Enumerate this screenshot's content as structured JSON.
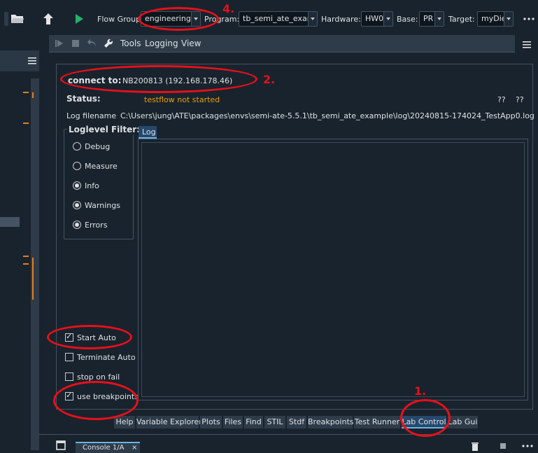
{
  "toolbar": {
    "flow_group_label": "Flow Group:",
    "flow_group_value": "engineering",
    "program_label": "Program:",
    "program_value": "tb_semi_ate_exam",
    "hardware_label": "Hardware:",
    "hardware_value": "HW0",
    "base_label": "Base:",
    "base_value": "PR",
    "target_label": "Target:",
    "target_value": "myDie"
  },
  "subtoolbar": {
    "menu_items": [
      "Tools",
      "Logging",
      "View"
    ]
  },
  "panel": {
    "connect_label": "connect to:",
    "connect_value": "NB200813 (192.168.178.46)",
    "status_label": "Status:",
    "status_value": "testflow not started",
    "status_q1": "??",
    "status_q2": "??",
    "log_filename_label": "Log filename",
    "log_filename_value": "C:\\Users\\jung\\ATE\\packages\\envs\\semi-ate-5.5.1\\tb_semi_ate_example\\log\\20240815-174024_TestApp0.log",
    "loglevel_title": "Loglevel Filter:",
    "loglevels": [
      {
        "label": "Debug",
        "selected": false
      },
      {
        "label": "Measure",
        "selected": false
      },
      {
        "label": "Info",
        "selected": true
      },
      {
        "label": "Warnings",
        "selected": true
      },
      {
        "label": "Errors",
        "selected": true
      }
    ],
    "log_tab": "Log",
    "options": [
      {
        "label": "Start Auto",
        "checked": true
      },
      {
        "label": "Terminate Auto",
        "checked": false
      },
      {
        "label": "stop on fail",
        "checked": false
      },
      {
        "label": "use breakpoints",
        "checked": true
      }
    ]
  },
  "bottom_tabs": [
    "Help",
    "Variable Explorer",
    "Plots",
    "Files",
    "Find",
    "STIL",
    "Stdf",
    "Breakpoints",
    "Test Runner",
    "Lab Control",
    "Lab Gui"
  ],
  "active_bottom_tab": "Lab Control",
  "console_tab": "Console 1/A",
  "annotations": {
    "a1": "1.",
    "a2": "2.",
    "a4": "4."
  },
  "colors": {
    "status_text": "#e8a000",
    "annotation": "#e8101a",
    "accent": "#6ab4e8"
  }
}
